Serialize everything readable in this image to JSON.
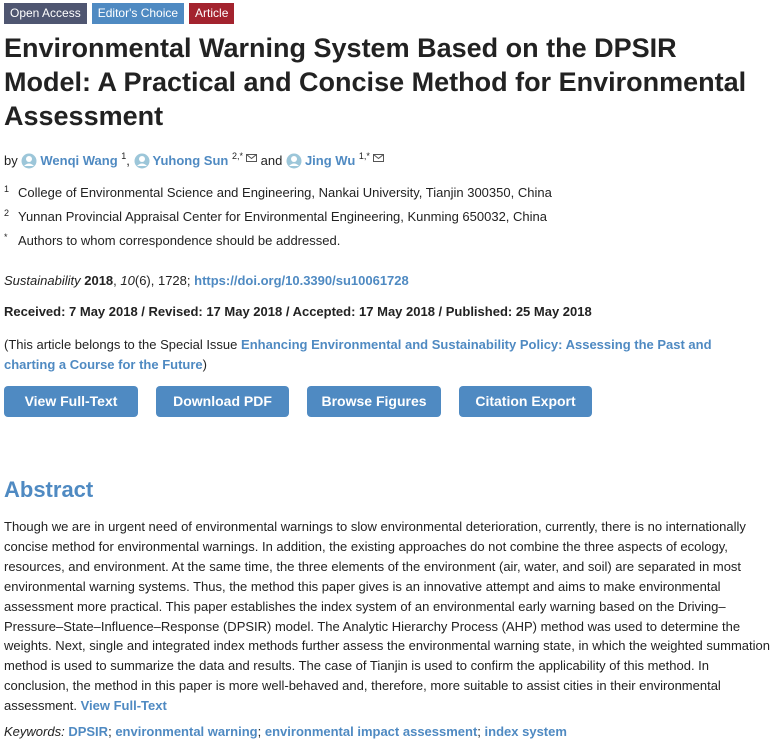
{
  "badges": {
    "open_access": "Open Access",
    "editors_choice": "Editor's Choice",
    "article": "Article"
  },
  "title": "Environmental Warning System Based on the DPSIR Model: A Practical and Concise Method for Environmental Assessment",
  "authors": {
    "by": "by",
    "list": [
      {
        "name": "Wenqi Wang",
        "sup": "1"
      },
      {
        "name": "Yuhong Sun",
        "sup": "2,*"
      },
      {
        "name": "Jing Wu",
        "sup": "1,*"
      }
    ],
    "comma": ",",
    "and": "and"
  },
  "affiliations": [
    {
      "num": "1",
      "text": "College of Environmental Science and Engineering, Nankai University, Tianjin 300350, China"
    },
    {
      "num": "2",
      "text": "Yunnan Provincial Appraisal Center for Environmental Engineering, Kunming 650032, China"
    },
    {
      "num": "*",
      "text": "Authors to whom correspondence should be addressed."
    }
  ],
  "citation": {
    "journal": "Sustainability",
    "year": "2018",
    "volume": "10",
    "issue_pages": "(6), 1728;",
    "doi": "https://doi.org/10.3390/su10061728"
  },
  "dates": "Received: 7 May 2018 / Revised: 17 May 2018 / Accepted: 17 May 2018 / Published: 25 May 2018",
  "special_issue": {
    "prefix": "(This article belongs to the Special Issue",
    "link": "Enhancing Environmental and Sustainability Policy: Assessing the Past and charting a Course for the Future",
    "suffix": ")"
  },
  "buttons": {
    "full_text": "View Full-Text",
    "download_pdf": "Download PDF",
    "browse_figures": "Browse Figures",
    "citation_export": "Citation Export"
  },
  "abstract": {
    "heading": "Abstract",
    "text": "Though we are in urgent need of environmental warnings to slow environmental deterioration, currently, there is no internationally concise method for environmental warnings. In addition, the existing approaches do not combine the three aspects of ecology, resources, and environment. At the same time, the three elements of the environment (air, water, and soil) are separated in most environmental warning systems. Thus, the method this paper gives is an innovative attempt and aims to make environmental assessment more practical. This paper establishes the index system of an environmental early warning based on the Driving–Pressure–State–Influence–Response (DPSIR) model. The Analytic Hierarchy Process (AHP) method was used to determine the weights. Next, single and integrated index methods further assess the environmental warning state, in which the weighted summation method is used to summarize the data and results. The case of Tianjin is used to confirm the applicability of this method. In conclusion, the method in this paper is more well-behaved and, therefore, more suitable to assist cities in their environmental assessment.",
    "view_full_text": "View Full-Text"
  },
  "keywords": {
    "label": "Keywords:",
    "items": [
      "DPSIR",
      "environmental warning",
      "environmental impact assessment",
      "index system"
    ],
    "separator": ";"
  },
  "colors": {
    "link": "#4f8ac2",
    "badge_open_access": "#4f5671",
    "badge_editors_choice": "#4f8ac2",
    "badge_article": "#a3232e"
  },
  "icons": {
    "author": "author-orcid-icon",
    "email": "envelope-icon"
  }
}
